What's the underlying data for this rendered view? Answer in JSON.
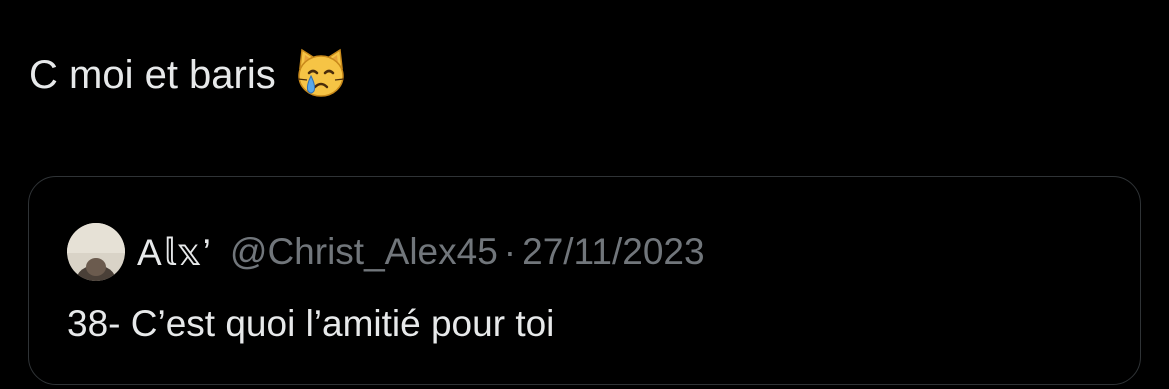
{
  "tweet": {
    "text": "C moi et baris",
    "emoji_icon": "crying-cat-face-icon"
  },
  "quoted_tweet": {
    "display_name": "A𝕝𝕩’",
    "handle": "@Christ_Alex45",
    "separator": "·",
    "date": "27/11/2023",
    "text": "38- C’est quoi l’amitié pour toi"
  },
  "colors": {
    "background": "#000000",
    "primary_text": "#e7e9ea",
    "secondary_text": "#71767b",
    "border": "#2f3336",
    "emoji_yellow": "#f6c445",
    "tear_blue": "#5aa8e8"
  }
}
